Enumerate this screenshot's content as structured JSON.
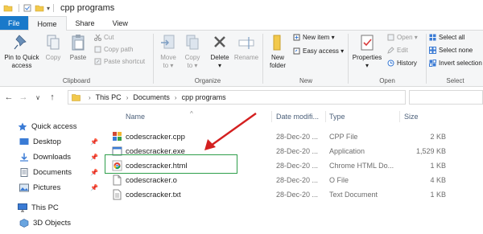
{
  "window": {
    "title": "cpp programs"
  },
  "tabs": [
    {
      "label": "File"
    },
    {
      "label": "Home"
    },
    {
      "label": "Share"
    },
    {
      "label": "View"
    }
  ],
  "ribbon": {
    "clipboard": {
      "pin_label_1": "Pin to Quick",
      "pin_label_2": "access",
      "copy": "Copy",
      "paste": "Paste",
      "cut": "Cut",
      "copy_path": "Copy path",
      "paste_shortcut": "Paste shortcut",
      "group": "Clipboard"
    },
    "organize": {
      "move_to_1": "Move",
      "move_to_2": "to ▾",
      "copy_to_1": "Copy",
      "copy_to_2": "to ▾",
      "delete_1": "Delete",
      "delete_2": "▾",
      "rename": "Rename",
      "group": "Organize"
    },
    "new": {
      "new_folder_1": "New",
      "new_folder_2": "folder",
      "new_item": "New item ▾",
      "easy_access": "Easy access ▾",
      "group": "New"
    },
    "open": {
      "properties_1": "Properties",
      "properties_2": "▾",
      "open": "Open ▾",
      "edit": "Edit",
      "history": "History",
      "group": "Open"
    },
    "select": {
      "select_all": "Select all",
      "select_none": "Select none",
      "invert": "Invert selection",
      "group": "Select"
    }
  },
  "address": {
    "crumbs": [
      "This PC",
      "Documents",
      "cpp programs"
    ],
    "sep": "›"
  },
  "nav": {
    "quick_access": "Quick access",
    "desktop": "Desktop",
    "downloads": "Downloads",
    "documents": "Documents",
    "pictures": "Pictures",
    "this_pc": "This PC",
    "objects_3d": "3D Objects",
    "pin_glyph": "📌"
  },
  "columns": {
    "name": "Name",
    "date": "Date modifi...",
    "type": "Type",
    "size": "Size"
  },
  "files": [
    {
      "name": "codescracker.cpp",
      "date": "28-Dec-20 ...",
      "type": "CPP File",
      "size": "2 KB",
      "icon": "cpp-file-icon"
    },
    {
      "name": "codescracker.exe",
      "date": "28-Dec-20 ...",
      "type": "Application",
      "size": "1,529 KB",
      "icon": "exe-file-icon"
    },
    {
      "name": "codescracker.html",
      "date": "28-Dec-20 ...",
      "type": "Chrome HTML Do...",
      "size": "1 KB",
      "icon": "chrome-html-icon"
    },
    {
      "name": "codescracker.o",
      "date": "28-Dec-20 ...",
      "type": "O File",
      "size": "4 KB",
      "icon": "o-file-icon"
    },
    {
      "name": "codescracker.txt",
      "date": "28-Dec-20 ...",
      "type": "Text Document",
      "size": "1 KB",
      "icon": "txt-file-icon"
    }
  ],
  "colors": {
    "file_tab": "#1979ca",
    "highlight": "#2e9e4a",
    "arrow": "#d42020",
    "folder": "#f2c94c"
  }
}
